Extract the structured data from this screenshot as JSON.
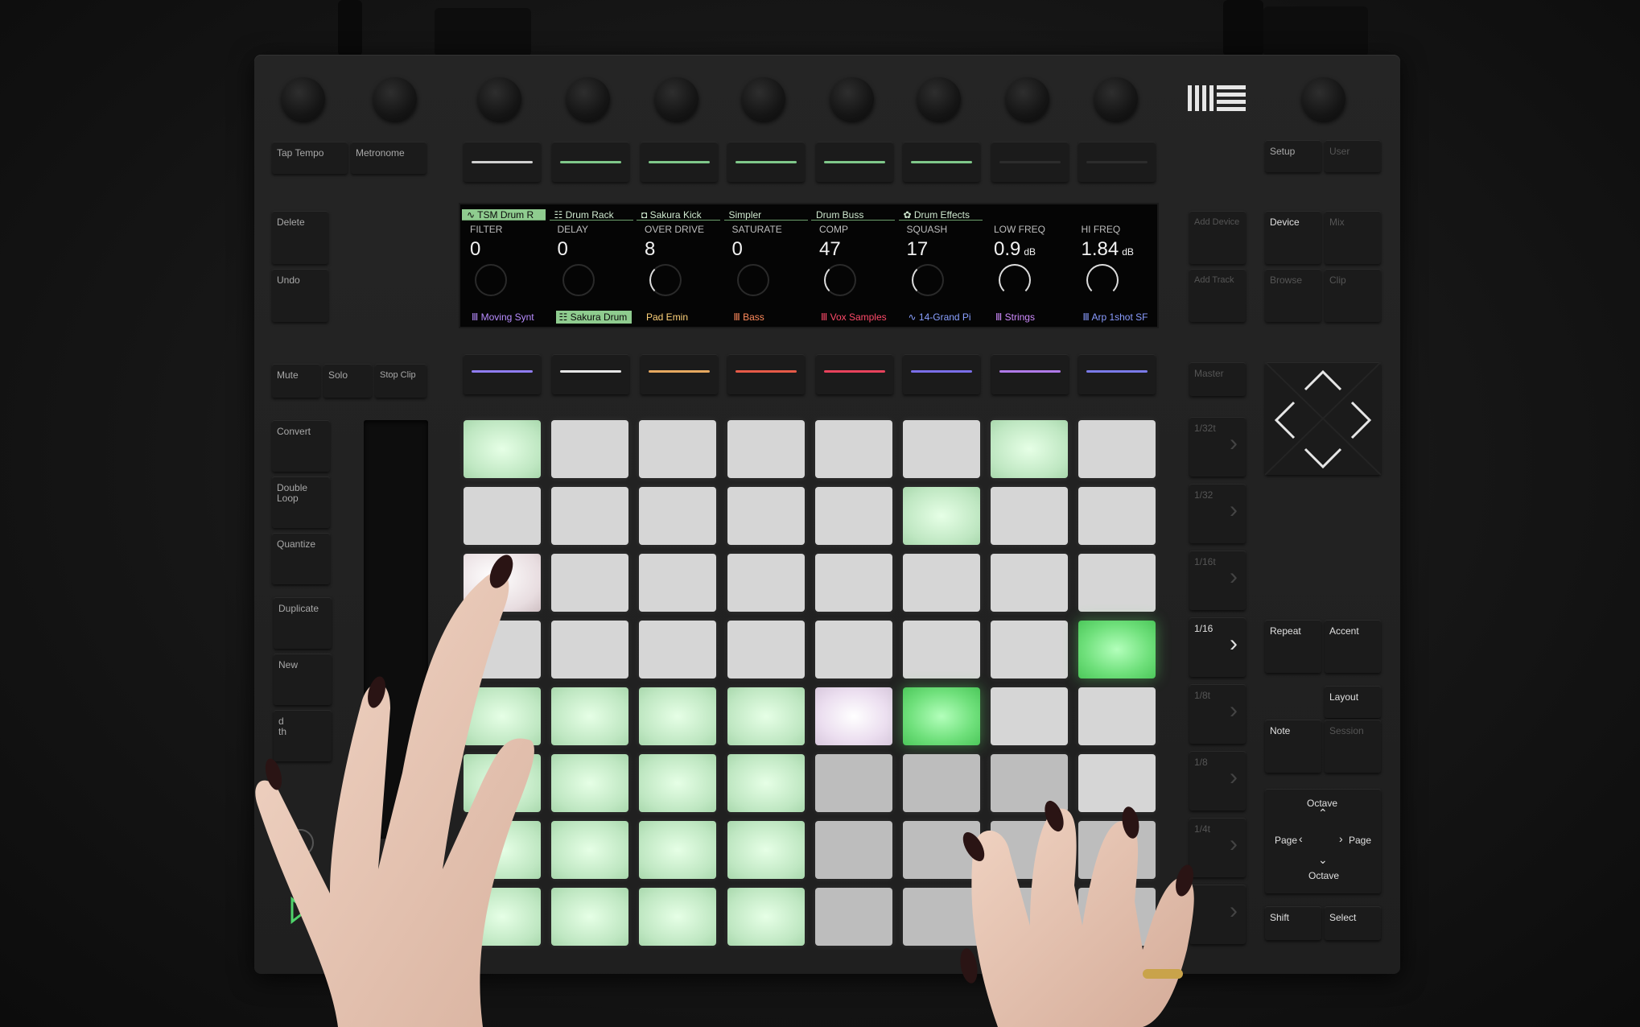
{
  "scene": "Ableton Push 2 controller with drum rack loaded, two hands playing pads",
  "left_buttons_top": {
    "tap_tempo": "Tap Tempo",
    "metronome": "Metronome"
  },
  "left_buttons": {
    "delete": "Delete",
    "undo": "Undo",
    "mute": "Mute",
    "solo": "Solo",
    "stop_clip": "Stop Clip",
    "convert": "Convert",
    "double_loop": "Double Loop",
    "quantize": "Quantize",
    "duplicate": "Duplicate",
    "new": "New",
    "fixed_length_partial": "d\nth"
  },
  "right_buttons": {
    "setup": "Setup",
    "user": "User",
    "add_device": "Add Device",
    "add_track": "Add Track",
    "device": "Device",
    "mix": "Mix",
    "browse": "Browse",
    "clip": "Clip",
    "master": "Master",
    "repeat": "Repeat",
    "accent": "Accent",
    "layout": "Layout",
    "note": "Note",
    "session": "Session",
    "octave_up": "Octave",
    "octave_down": "Octave",
    "page_left": "Page",
    "page_right": "Page",
    "shift": "Shift",
    "select": "Select"
  },
  "scene_buttons": [
    "1/32t",
    "1/32",
    "1/16t",
    "1/16",
    "1/8t",
    "1/8",
    "1/4t",
    ""
  ],
  "display": {
    "tabs": [
      {
        "label": "∿ TSM Drum R",
        "active": true
      },
      {
        "label": "☷ Drum Rack",
        "active": false
      },
      {
        "label": "◘ Sakura Kick",
        "active": false
      },
      {
        "label": "Simpler",
        "active": false
      },
      {
        "label": "Drum Buss",
        "active": false
      },
      {
        "label": "✿ Drum Effects",
        "active": false
      },
      {
        "label": "",
        "active": false
      },
      {
        "label": "",
        "active": false
      }
    ],
    "params": [
      {
        "name": "FILTER",
        "value": "0",
        "unit": "",
        "dial": "off"
      },
      {
        "name": "DELAY",
        "value": "0",
        "unit": "",
        "dial": "off"
      },
      {
        "name": "OVER DRIVE",
        "value": "8",
        "unit": "",
        "dial": "low"
      },
      {
        "name": "SATURATE",
        "value": "0",
        "unit": "",
        "dial": "off"
      },
      {
        "name": "COMP",
        "value": "47",
        "unit": "",
        "dial": "mid"
      },
      {
        "name": "SQUASH",
        "value": "17",
        "unit": "",
        "dial": "low"
      },
      {
        "name": "LOW FREQ",
        "value": "0.9",
        "unit": "dB",
        "dial": "hi"
      },
      {
        "name": "HI FREQ",
        "value": "1.84",
        "unit": "dB",
        "dial": "hi"
      }
    ],
    "tracks": [
      {
        "label": "Ⅲ Moving Synt",
        "color": "#b88cff",
        "selected": false
      },
      {
        "label": "☷ Sakura Drum",
        "color": "#0a0a0a",
        "selected": true
      },
      {
        "label": "Pad Emin",
        "color": "#ffd27a",
        "selected": false
      },
      {
        "label": "Ⅲ Bass",
        "color": "#ff8a5c",
        "selected": false
      },
      {
        "label": "Ⅲ Vox Samples",
        "color": "#ff4a6a",
        "selected": false
      },
      {
        "label": "∿ 14-Grand Pi",
        "color": "#8aa0ff",
        "selected": false
      },
      {
        "label": "Ⅲ Strings",
        "color": "#d08cff",
        "selected": false
      },
      {
        "label": "Ⅲ Arp 1shot SF",
        "color": "#8a9cff",
        "selected": false
      }
    ]
  },
  "top_strip_leds": [
    "#d0d0d0",
    "#7fc88a",
    "#7fc88a",
    "#7fc88a",
    "#7fc88a",
    "#7fc88a",
    "#2c2c2c",
    "#2c2c2c"
  ],
  "bottom_strip_leds": [
    "#8f7cf0",
    "#e6e6e6",
    "#e6a860",
    "#e65a48",
    "#e8425c",
    "#7a6ee8",
    "#b07ae8",
    "#7a7ae8"
  ],
  "pad_grid": [
    [
      "pale",
      "white",
      "white",
      "white",
      "white",
      "white",
      "pale",
      "white"
    ],
    [
      "white",
      "white",
      "white",
      "white",
      "white",
      "pale",
      "white",
      "white"
    ],
    [
      "pinkish",
      "white",
      "white",
      "white",
      "white",
      "white",
      "white",
      "white"
    ],
    [
      "white",
      "white",
      "white",
      "white",
      "white",
      "white",
      "white",
      "green"
    ],
    [
      "pale",
      "pale",
      "pale",
      "pale",
      "lav",
      "green",
      "white",
      "white"
    ],
    [
      "pale",
      "pale",
      "pale",
      "pale",
      "grey",
      "grey",
      "grey",
      "white"
    ],
    [
      "pale",
      "pale",
      "pale",
      "pale",
      "grey",
      "grey",
      "grey",
      "grey"
    ],
    [
      "pale",
      "pale",
      "pale",
      "pale",
      "grey",
      "grey",
      "grey",
      "grey"
    ]
  ]
}
